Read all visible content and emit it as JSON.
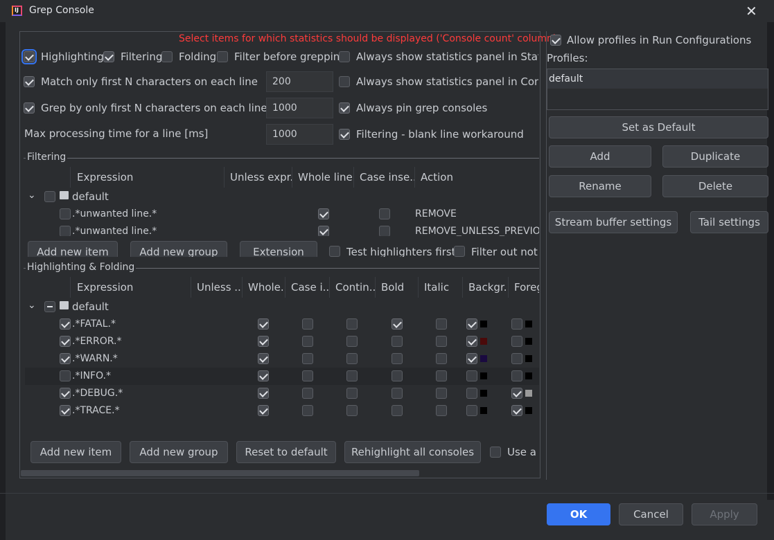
{
  "window": {
    "title": "Grep Console",
    "close": "✕"
  },
  "notice": "Select items for which statistics should be displayed ('Console count' column)",
  "options": {
    "highlighting": "Highlighting",
    "filtering": "Filtering",
    "folding": "Folding",
    "filter_before_grepping": "Filter before grepping",
    "always_show_stats_status": "Always show statistics panel in Status Ba",
    "match_first_n": "Match only first N characters on each line",
    "match_first_n_value": "200",
    "always_show_stats_console": "Always show statistics panel in Console",
    "grep_first_n": "Grep by only first N characters on each line",
    "grep_first_n_value": "1000",
    "always_pin": "Always pin grep consoles",
    "max_processing": "Max processing time for a line [ms]",
    "max_processing_value": "1000",
    "blank_line_workaround": "Filtering - blank line workaround"
  },
  "filtering": {
    "title": "Filtering",
    "headers": [
      "Expression",
      "Unless expr...",
      "Whole line",
      "Case inse...",
      "Action"
    ],
    "group": "default",
    "rows": [
      {
        "expr": ".*unwanted line.*",
        "whole": true,
        "case": false,
        "action": "REMOVE"
      },
      {
        "expr": ".*unwanted line.*",
        "whole": true,
        "case": false,
        "action": "REMOVE_UNLESS_PREVIOU"
      }
    ],
    "buttons": [
      "Add new item",
      "Add new group",
      "Extension",
      "Test highlighters first",
      "Filter out not m"
    ]
  },
  "highlighting": {
    "title": "Highlighting & Folding",
    "headers": [
      "Expression",
      "Unless ...",
      "Whole...",
      "Case i...",
      "Contin...",
      "Bold",
      "Italic",
      "Backgr...",
      "Foreg"
    ],
    "group": "default",
    "rows": [
      {
        "expr": ".*FATAL.*",
        "enabled": true,
        "whole": true,
        "bold": true,
        "bg": true,
        "bg_color": "#000000",
        "fg": false,
        "fg_color": "#000000"
      },
      {
        "expr": ".*ERROR.*",
        "enabled": true,
        "whole": true,
        "bold": false,
        "bg": true,
        "bg_color": "#4a0a0a",
        "fg": false,
        "fg_color": "#000000"
      },
      {
        "expr": ".*WARN.*",
        "enabled": true,
        "whole": true,
        "bold": false,
        "bg": true,
        "bg_color": "#1a0a40",
        "fg": false,
        "fg_color": "#000000"
      },
      {
        "expr": ".*INFO.*",
        "enabled": false,
        "whole": true,
        "bold": false,
        "bg": false,
        "bg_color": "#000000",
        "fg": false,
        "fg_color": "#000000"
      },
      {
        "expr": ".*DEBUG.*",
        "enabled": true,
        "whole": true,
        "bold": false,
        "bg": false,
        "bg_color": "#000000",
        "fg": true,
        "fg_color": "#9a9a9a"
      },
      {
        "expr": ".*TRACE.*",
        "enabled": true,
        "whole": true,
        "bold": false,
        "bg": false,
        "bg_color": "#000000",
        "fg": true,
        "fg_color": "#000000"
      }
    ],
    "buttons": [
      "Add new item",
      "Add new group",
      "Reset to default",
      "Rehighlight all consoles",
      "Use a p"
    ]
  },
  "profiles": {
    "allow_in_run_configs": "Allow profiles in Run Configurations",
    "label": "Profiles:",
    "items": [
      "default"
    ],
    "set_default": "Set as Default",
    "add": "Add",
    "duplicate": "Duplicate",
    "rename": "Rename",
    "delete": "Delete",
    "stream_buffer": "Stream buffer settings",
    "tail": "Tail settings"
  },
  "footer": {
    "ok": "OK",
    "cancel": "Cancel",
    "apply": "Apply"
  }
}
